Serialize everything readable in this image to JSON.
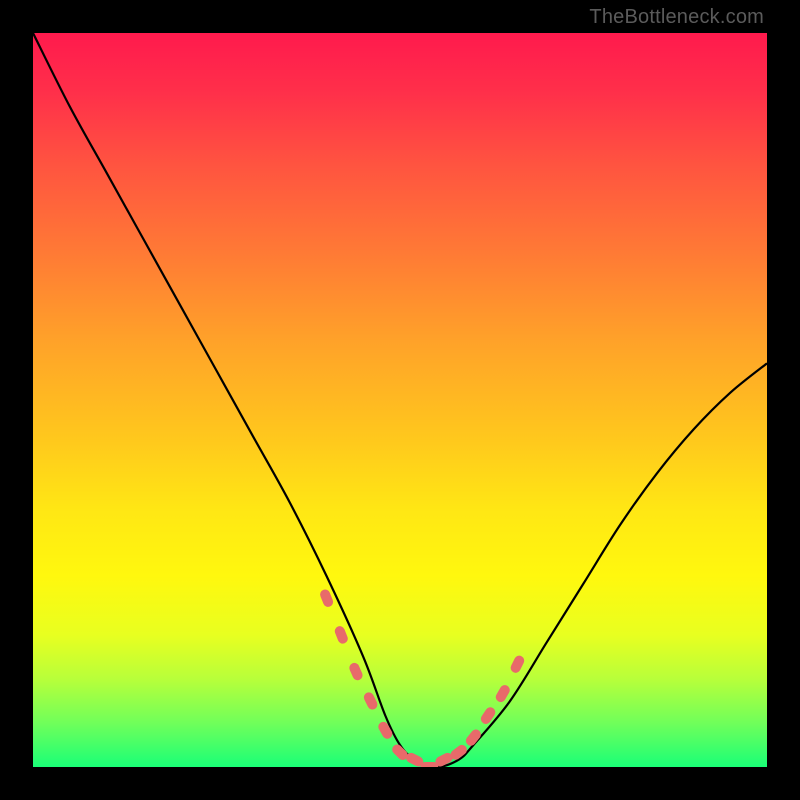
{
  "attribution": "TheBottleneck.com",
  "colors": {
    "background": "#000000",
    "gradient_top": "#ff1a4d",
    "gradient_bottom": "#1aff77",
    "curve": "#000000",
    "markers": "#e86a6a"
  },
  "chart_data": {
    "type": "line",
    "title": "",
    "xlabel": "",
    "ylabel": "",
    "xlim": [
      0,
      100
    ],
    "ylim": [
      0,
      100
    ],
    "grid": false,
    "legend": false,
    "series": [
      {
        "name": "bottleneck-curve",
        "x": [
          0,
          5,
          10,
          15,
          20,
          25,
          30,
          35,
          40,
          45,
          48,
          50,
          52,
          55,
          58,
          60,
          65,
          70,
          75,
          80,
          85,
          90,
          95,
          100
        ],
        "y": [
          100,
          90,
          81,
          72,
          63,
          54,
          45,
          36,
          26,
          15,
          7,
          3,
          1,
          0,
          1,
          3,
          9,
          17,
          25,
          33,
          40,
          46,
          51,
          55
        ]
      }
    ],
    "markers": {
      "name": "highlighted-points",
      "x": [
        40,
        42,
        44,
        46,
        48,
        50,
        52,
        54,
        56,
        58,
        60,
        62,
        64,
        66
      ],
      "y": [
        23,
        18,
        13,
        9,
        5,
        2,
        1,
        0,
        1,
        2,
        4,
        7,
        10,
        14
      ]
    }
  }
}
